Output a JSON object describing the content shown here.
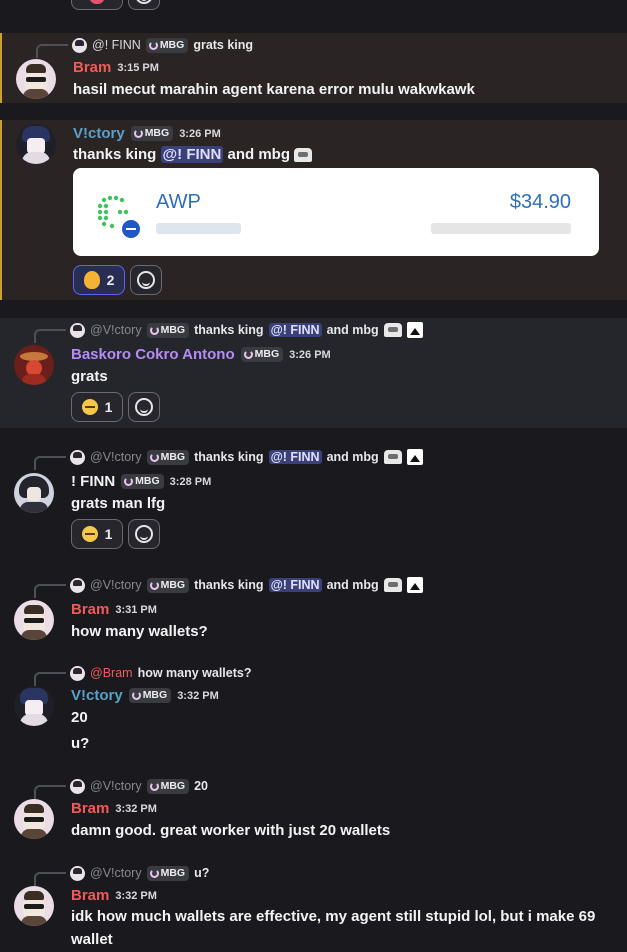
{
  "top_fragment": {
    "label": "top reactions cut off"
  },
  "messages": [
    {
      "reply": {
        "name": "@! FINN",
        "tag": "MBG",
        "text": "grats king"
      },
      "author": "Bram",
      "time": "3:15 PM",
      "lines": [
        "hasil mecut marahin agent karena error mulu wakwkawk"
      ]
    },
    {
      "author": "V!ctory",
      "tag": "MBG",
      "time": "3:26 PM",
      "text_before": "thanks king",
      "mention": "@! FINN",
      "text_after": "and mbg",
      "card": {
        "ticker": "AWP",
        "price": "$34.90"
      },
      "reactions": [
        {
          "count": "2",
          "icon": "fire"
        }
      ]
    },
    {
      "reply": {
        "name": "@V!ctory",
        "tag": "MBG",
        "text_before": "thanks king",
        "mention": "@! FINN",
        "text_after": "and mbg"
      },
      "author": "Baskoro Cokro Antono",
      "tag": "MBG",
      "time": "3:26 PM",
      "lines": [
        "grats"
      ],
      "reactions": [
        {
          "count": "1",
          "icon": "sleepy"
        }
      ]
    },
    {
      "reply": {
        "name": "@V!ctory",
        "tag": "MBG",
        "text_before": "thanks king",
        "mention": "@! FINN",
        "text_after": "and mbg"
      },
      "author": "! FINN",
      "tag": "MBG",
      "time": "3:28 PM",
      "lines": [
        "grats man lfg"
      ],
      "reactions": [
        {
          "count": "1",
          "icon": "sleepy"
        }
      ]
    },
    {
      "reply": {
        "name": "@V!ctory",
        "tag": "MBG",
        "text_before": "thanks king",
        "mention": "@! FINN",
        "text_after": "and mbg"
      },
      "author": "Bram",
      "time": "3:31 PM",
      "lines": [
        "how many wallets?"
      ]
    },
    {
      "reply": {
        "name": "@Bram",
        "text": "how many wallets?"
      },
      "author": "V!ctory",
      "tag": "MBG",
      "time": "3:32 PM",
      "lines": [
        "20",
        "u?"
      ]
    },
    {
      "reply": {
        "name": "@V!ctory",
        "tag": "MBG",
        "text": "20"
      },
      "author": "Bram",
      "time": "3:32 PM",
      "lines": [
        "damn good. great worker with just 20 wallets"
      ]
    },
    {
      "reply": {
        "name": "@V!ctory",
        "tag": "MBG",
        "text": "u?"
      },
      "author": "Bram",
      "time": "3:32 PM",
      "lines": [
        "idk how much wallets are effective, my agent still stupid lol, but i make 69",
        "wallet"
      ]
    }
  ]
}
